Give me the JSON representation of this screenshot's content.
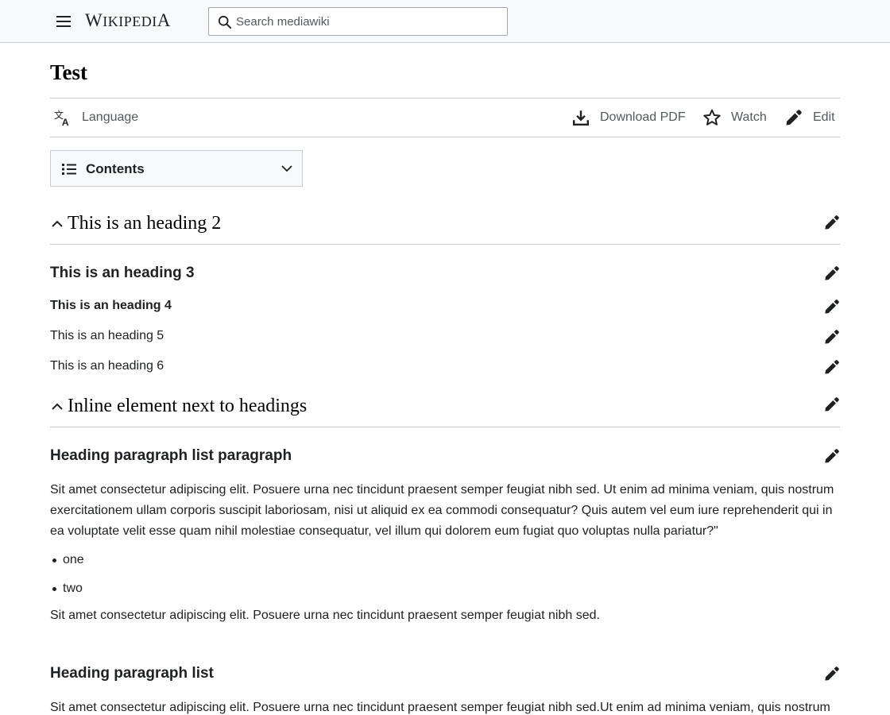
{
  "header": {
    "logo_text": "Wikipedia",
    "search_placeholder": "Search mediawiki"
  },
  "page": {
    "title": "Test"
  },
  "toolbar": {
    "language": "Language",
    "download_pdf": "Download PDF",
    "watch": "Watch",
    "edit": "Edit"
  },
  "toc": {
    "label": "Contents"
  },
  "sections": {
    "h2_a": "This is an heading 2",
    "h3": "This is an heading 3",
    "h4": "This is an heading 4",
    "h5": "This is an heading 5",
    "h6": "This is an heading 6",
    "h2_b": "Inline element next to headings",
    "h3_hplp": "Heading paragraph list paragraph",
    "hplp_para1": "Sit amet consectetur adipiscing elit. Posuere urna nec tincidunt praesent semper feugiat nibh sed. Ut enim ad minima veniam, quis nostrum exercitationem ullam corporis suscipit laboriosam, nisi ut aliquid ex ea commodi consequatur? Quis autem vel eum iure reprehenderit qui in ea voluptate velit esse quam nihil molestiae consequatur, vel illum qui dolorem eum fugiat quo voluptas nulla pariatur?\"",
    "hplp_list": [
      "one",
      "two"
    ],
    "hplp_para2": "Sit amet consectetur adipiscing elit. Posuere urna nec tincidunt praesent semper feugiat nibh sed.",
    "h3_hpl": "Heading paragraph list",
    "hpl_para1": "Sit amet consectetur adipiscing elit. Posuere urna nec tincidunt praesent semper feugiat nibh sed.Ut enim ad minima veniam, quis nostrum"
  },
  "colors": {
    "link_gray": "#54595d",
    "border": "#c8ccd1",
    "header_bg": "#f8f9fa"
  },
  "icons": {
    "menu": "hamburger-menu-icon",
    "search": "search-icon",
    "language": "language-icon",
    "download": "download-icon",
    "watch": "star-icon",
    "edit": "pencil-icon",
    "toc": "list-icon",
    "collapse": "chevron-up-icon"
  }
}
